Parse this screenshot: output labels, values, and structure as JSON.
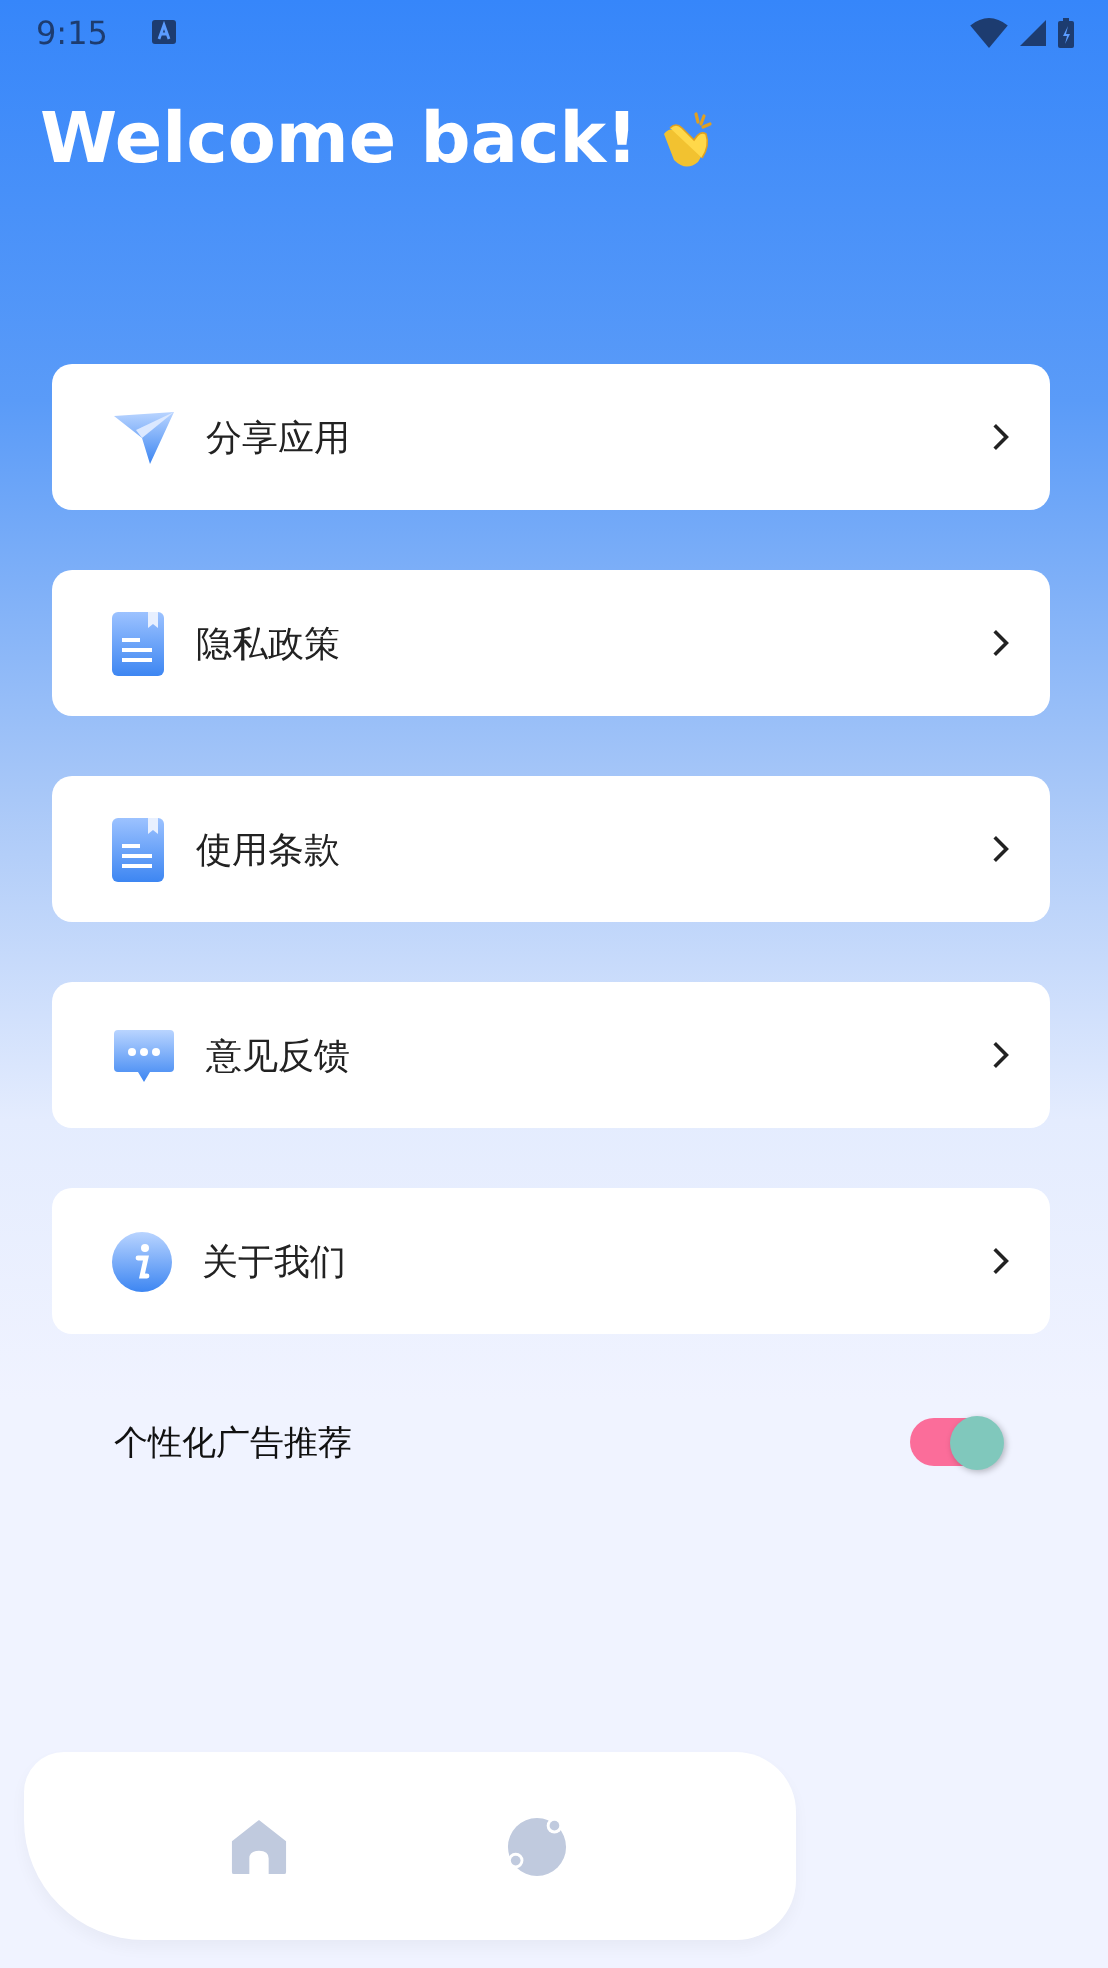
{
  "status_bar": {
    "time": "9:15"
  },
  "header": {
    "title": "Welcome back!"
  },
  "menu": [
    {
      "kind": "share",
      "label": "分享应用"
    },
    {
      "kind": "doc",
      "label": "隐私政策"
    },
    {
      "kind": "doc",
      "label": "使用条款"
    },
    {
      "kind": "chat",
      "label": "意见反馈"
    },
    {
      "kind": "info",
      "label": "关于我们"
    }
  ],
  "setting": {
    "label": "个性化广告推荐",
    "on": true
  },
  "bottom_nav": [
    {
      "kind": "home"
    },
    {
      "kind": "planet"
    }
  ]
}
